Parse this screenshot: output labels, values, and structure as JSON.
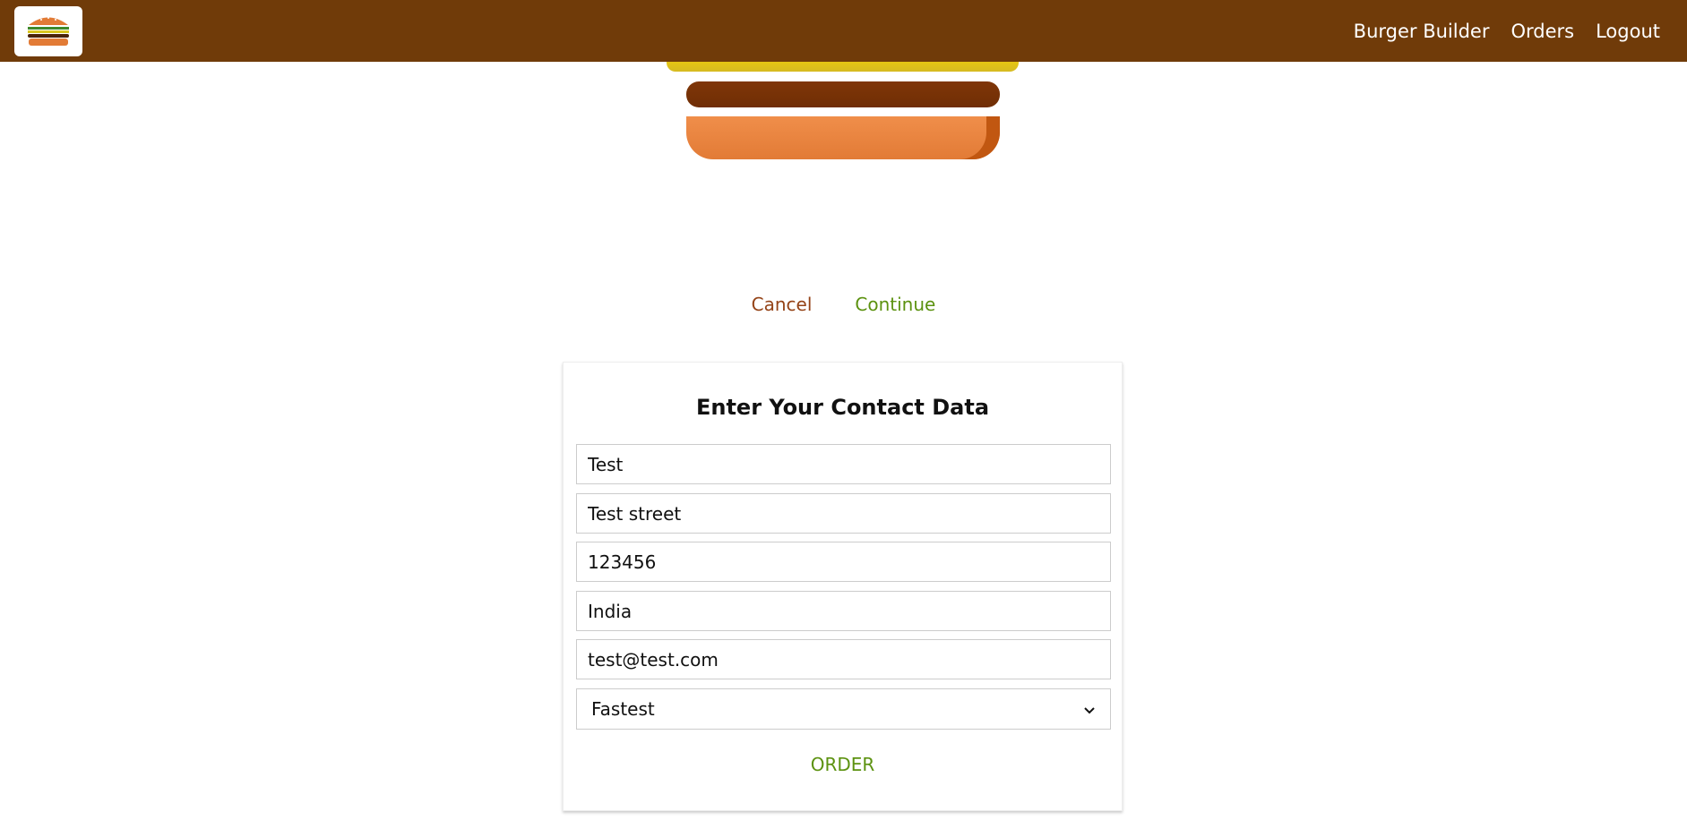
{
  "nav": {
    "logo_alt": "burger-logo",
    "items": [
      {
        "label": "Burger Builder"
      },
      {
        "label": "Orders"
      },
      {
        "label": "Logout"
      }
    ]
  },
  "checkout": {
    "cancel_label": "Cancel",
    "continue_label": "Continue"
  },
  "contact": {
    "title": "Enter Your Contact Data",
    "fields": {
      "name": "Test",
      "street": "Test street",
      "zip": "123456",
      "country": "India",
      "email": "test@test.com"
    },
    "delivery_method": "Fastest",
    "order_label": "ORDER"
  },
  "colors": {
    "toolbar": "#703B09",
    "danger": "#944317",
    "success": "#5C9210"
  }
}
